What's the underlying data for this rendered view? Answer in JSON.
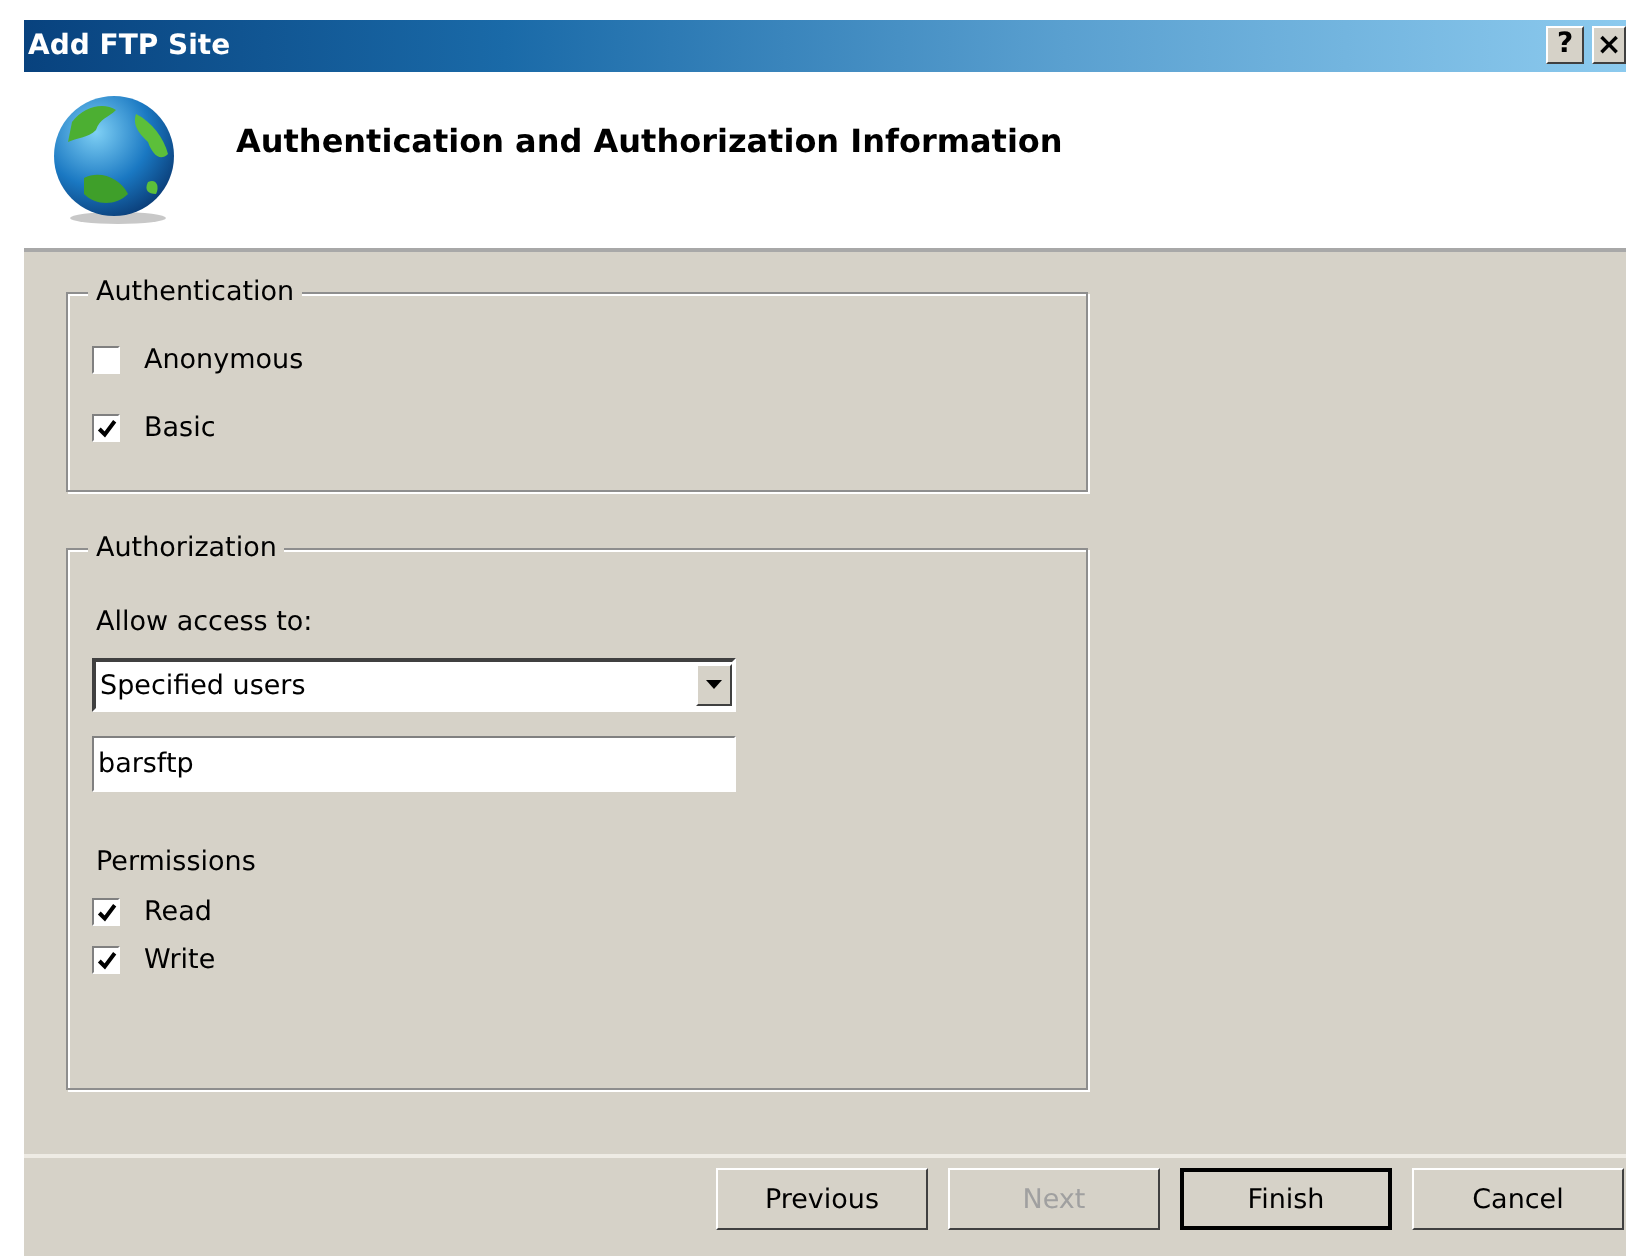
{
  "window": {
    "title": "Add FTP Site",
    "controls": [
      {
        "kind": "help",
        "label": "?"
      },
      {
        "kind": "close",
        "label": "×"
      }
    ]
  },
  "header": {
    "title": "Authentication and Authorization Information"
  },
  "authentication": {
    "legend": "Authentication",
    "options": [
      {
        "label": "Anonymous",
        "checked": false
      },
      {
        "label": "Basic",
        "checked": true
      }
    ]
  },
  "authorization": {
    "legend": "Authorization",
    "access_label": "Allow access to:",
    "access": {
      "value": "Specified users"
    },
    "users": {
      "value": "barsftp"
    },
    "permissions_label": "Permissions",
    "permissions": [
      {
        "label": "Read",
        "checked": true
      },
      {
        "label": "Write",
        "checked": true
      }
    ]
  },
  "buttons": [
    {
      "label": "Previous",
      "disabled": false,
      "default": false
    },
    {
      "label": "Next",
      "disabled": true,
      "default": false
    },
    {
      "label": "Finish",
      "disabled": false,
      "default": true
    },
    {
      "label": "Cancel",
      "disabled": false,
      "default": false
    }
  ]
}
